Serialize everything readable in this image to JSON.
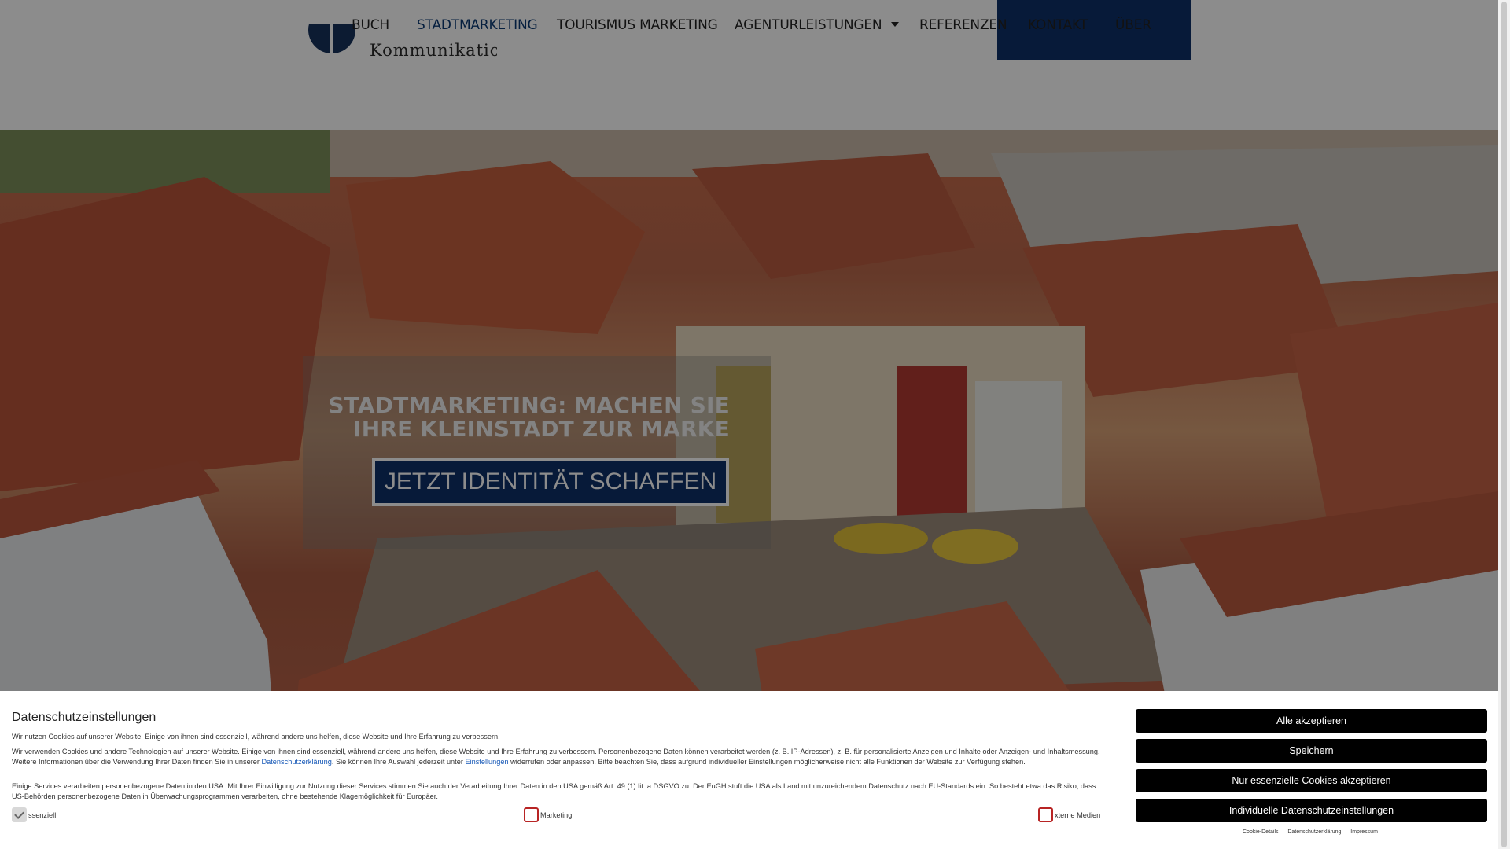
{
  "nav": {
    "items": [
      {
        "label": "BUCH"
      },
      {
        "label": "STADTMARKETING"
      },
      {
        "label": "TOURISMUS MARKETING"
      },
      {
        "label": "AGENTURLEISTUNGEN"
      },
      {
        "label": "REFERENZEN"
      },
      {
        "label": "KONTAKT"
      },
      {
        "label": "ÜBER"
      }
    ],
    "active": "STADTMARKETING"
  },
  "logo": {
    "text": "Kommunikation"
  },
  "hero": {
    "title_line1": "STADTMARKETING: MACHEN SIE",
    "title_line2": "IHRE KLEINSTADT ZUR MARKE",
    "cta_label": "JETZT IDENTITÄT SCHAFFEN"
  },
  "cookie": {
    "title": "Datenschutzeinstellungen",
    "intro": "Wir nutzen Cookies auf unserer Website. Einige von ihnen sind essenziell, während andere uns helfen, diese Website und Ihre Erfahrung zu verbessern.",
    "para1_a": "Wir verwenden Cookies und andere Technologien auf unserer Website. Einige von ihnen sind essenziell, während andere uns helfen, diese Website und Ihre Erfahrung zu verbessern. Personenbezogene Daten können verarbeitet werden (z. B. IP-Adressen), z. B. für personalisierte Anzeigen und Inhalte oder Anzeigen- und Inhaltsmessung. Weitere Informationen über die Verwendung Ihrer Daten finden Sie in unserer ",
    "para1_link1": "Datenschutzerklärung",
    "para1_b": ". Sie können Ihre Auswahl jederzeit unter ",
    "para1_link2": "Einstellungen",
    "para1_c": " widerrufen oder anpassen. Bitte beachten Sie, dass aufgrund individueller Einstellungen möglicherweise nicht alle Funktionen der Website zur Verfügung stehen.",
    "para2": "Einige Services verarbeiten personenbezogene Daten in den USA. Mit Ihrer Einwilligung zur Nutzung dieser Services stimmen Sie auch der Verarbeitung Ihrer Daten in den USA gemäß Art. 49 (1) lit. a DSGVO zu. Der EuGH stuft die USA als Land mit unzureichendem Datenschutz nach EU-Standards ein. So besteht etwa das Risiko, dass US-Behörden personenbezogene Daten in Überwachungsprogrammen verarbeiten, ohne bestehende Klagemöglichkeit für Europäer.",
    "checks": [
      {
        "label": "ssenziell",
        "checked": true
      },
      {
        "label": "Marketing",
        "checked": false
      },
      {
        "label": "xterne Medien",
        "checked": false
      }
    ],
    "buttons": {
      "accept_all": "Alle akzeptieren",
      "save": "Speichern",
      "essential_only": "Nur essenzielle Cookies akzeptieren",
      "individual": "Individuelle Datenschutzeinstellungen"
    },
    "footer_links": {
      "details": "Cookie-Details",
      "privacy": "Datenschutzerklärung",
      "imprint": "Impressum",
      "separator": "|"
    }
  },
  "colors": {
    "brand_navy": "#0e3068",
    "active_nav": "#0b3a73",
    "checkbox_border": "#b82424",
    "link": "#1658b7"
  }
}
